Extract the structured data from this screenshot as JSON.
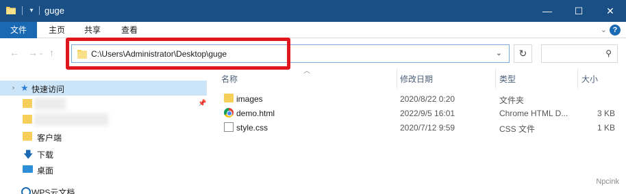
{
  "window": {
    "title": "guge",
    "minimize_glyph": "—",
    "maximize_glyph": "☐",
    "close_glyph": "✕"
  },
  "ribbon": {
    "tabs": [
      {
        "label": "文件"
      },
      {
        "label": "主页"
      },
      {
        "label": "共享"
      },
      {
        "label": "查看"
      }
    ]
  },
  "navigation": {
    "back_glyph": "←",
    "forward_glyph": "→",
    "up_glyph": "↑",
    "address_path": "C:\\Users\\Administrator\\Desktop\\guge",
    "refresh_glyph": "↻",
    "search_placeholder": ""
  },
  "sidebar": {
    "items": [
      {
        "label": "快速访问",
        "icon": "star-icon"
      },
      {
        "label": "",
        "icon": "folder-icon"
      },
      {
        "label": "",
        "icon": "folder-icon"
      },
      {
        "label": "客户端",
        "icon": "folder-icon"
      },
      {
        "label": "下载",
        "icon": "download-icon"
      },
      {
        "label": "桌面",
        "icon": "desktop-icon"
      },
      {
        "label": "WPS云文档",
        "icon": "wps-icon"
      }
    ]
  },
  "filelist": {
    "columns": [
      "名称",
      "修改日期",
      "类型",
      "大小"
    ],
    "rows": [
      {
        "name": "images",
        "date": "2020/8/22 0:20",
        "type": "文件夹",
        "size": "",
        "icon": "folder-icon"
      },
      {
        "name": "demo.html",
        "date": "2022/9/5 16:01",
        "type": "Chrome HTML D...",
        "size": "3 KB",
        "icon": "chrome-icon"
      },
      {
        "name": "style.css",
        "date": "2020/7/12 9:59",
        "type": "CSS 文件",
        "size": "1 KB",
        "icon": "css-file-icon"
      }
    ]
  },
  "watermark": "Npcink",
  "colors": {
    "titlebar": "#1a4f85",
    "file_tab": "#1a6ab3",
    "highlight": "#e0161d",
    "selected": "#cce4f7"
  }
}
